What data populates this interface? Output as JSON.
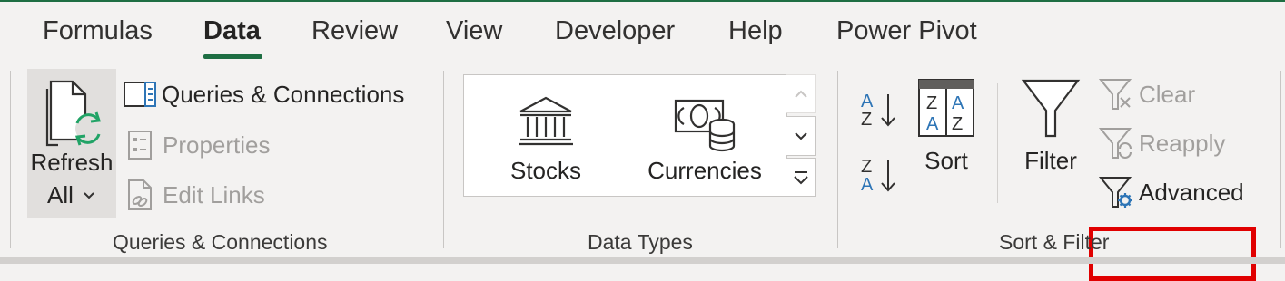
{
  "tabs": [
    {
      "label": "Formulas",
      "active": false
    },
    {
      "label": "Data",
      "active": true
    },
    {
      "label": "Review",
      "active": false
    },
    {
      "label": "View",
      "active": false
    },
    {
      "label": "Developer",
      "active": false
    },
    {
      "label": "Help",
      "active": false
    },
    {
      "label": "Power Pivot",
      "active": false
    }
  ],
  "groups": {
    "queries": {
      "label": "Queries & Connections",
      "refresh_all_line1": "Refresh",
      "refresh_all_line2": "All",
      "queries_connections": "Queries & Connections",
      "properties": "Properties",
      "edit_links": "Edit Links"
    },
    "data_types": {
      "label": "Data Types",
      "stocks": "Stocks",
      "currencies": "Currencies"
    },
    "sort_filter": {
      "label": "Sort & Filter",
      "sort": "Sort",
      "filter": "Filter",
      "clear": "Clear",
      "reapply": "Reapply",
      "advanced": "Advanced",
      "sort_az_top": "A",
      "sort_az_bottom": "Z",
      "sort_za_top": "Z",
      "sort_za_bottom": "A",
      "sort_grid_z1": "Z",
      "sort_grid_a1": "A",
      "sort_grid_a2": "A",
      "sort_grid_z2": "Z"
    }
  },
  "colors": {
    "accent": "#1e6e43",
    "highlight": "#e00000",
    "icon_blue": "#2e75b6",
    "icon_green": "#21a366"
  }
}
